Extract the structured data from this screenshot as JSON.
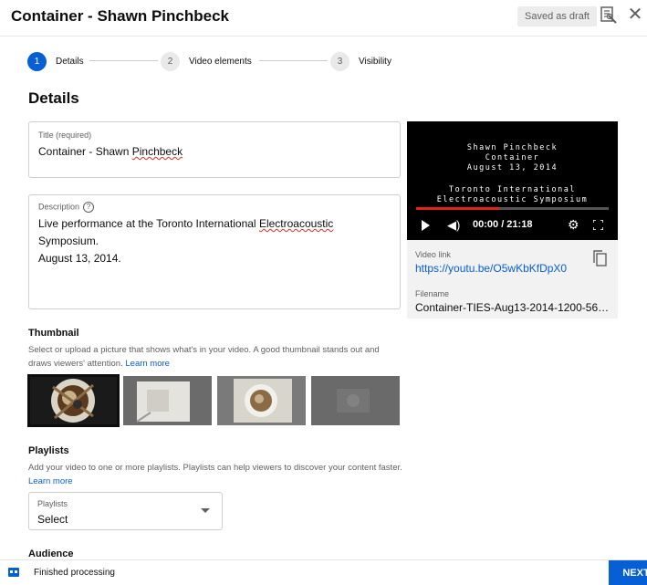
{
  "header": {
    "title": "Container - Shawn Pinchbeck",
    "draft_status": "Saved as draft"
  },
  "stepper": {
    "steps": [
      {
        "number": "1",
        "label": "Details",
        "state": "active"
      },
      {
        "number": "2",
        "label": "Video elements",
        "state": "pending"
      },
      {
        "number": "3",
        "label": "Visibility",
        "state": "pending"
      }
    ]
  },
  "details": {
    "heading": "Details",
    "title_field": {
      "label": "Title (required)",
      "value_plain": "Container - Shawn ",
      "value_flagged": "Pinchbeck"
    },
    "description_field": {
      "label": "Description",
      "help_icon": "help-circle-icon",
      "line1_before": "Live performance at the Toronto International ",
      "line1_flagged": "Electroacoustic",
      "line1_after": " Symposium.",
      "line2": "August 13, 2014."
    }
  },
  "video_preview": {
    "frame_text": {
      "line1": "Shawn Pinchbeck",
      "line2": "Container",
      "line3": "August 13, 2014",
      "line4": "Toronto International",
      "line5": "Electroacoustic Symposium"
    },
    "time": "00:00 / 21:18",
    "progress_fraction": 0.43,
    "video_link_label": "Video link",
    "video_link": "https://youtu.be/O5wKbKfDpX0",
    "filename_label": "Filename",
    "filename": "Container-TIES-Aug13-2014-1200-560...."
  },
  "thumbnail": {
    "title": "Thumbnail",
    "desc": "Select or upload a picture that shows what's in your video. A good thumbnail stands out and draws viewers' attention.",
    "learn_more": "Learn more",
    "selected_index": 0
  },
  "playlists": {
    "title": "Playlists",
    "desc": "Add your video to one or more playlists. Playlists can help viewers to discover your content faster.",
    "learn_more": "Learn more",
    "dropdown_label": "Playlists",
    "dropdown_value": "Select"
  },
  "audience": {
    "title": "Audience"
  },
  "footer": {
    "status": "Finished processing",
    "next_label": "NEXT"
  },
  "colors": {
    "accent": "#065fd4",
    "progress": "#e62117",
    "spellcheck": "#d93025"
  }
}
